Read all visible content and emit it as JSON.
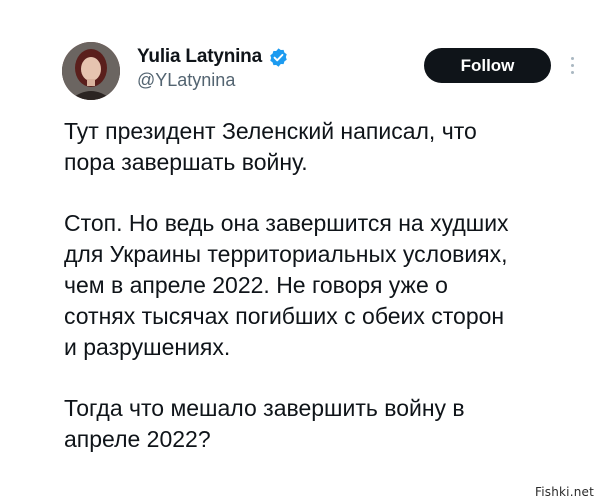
{
  "author": {
    "display_name": "Yulia Latynina",
    "handle": "@YLatynina",
    "verified": true,
    "avatar_icon": "user-avatar"
  },
  "actions": {
    "follow_label": "Follow",
    "more_icon": "more-vertical-icon"
  },
  "tweet": {
    "paragraphs": [
      [
        "Тут президент Зеленский написал, что",
        "пора завершать войну."
      ],
      [
        "Стоп. Но ведь она завершится на худших",
        "для Украины территориальных условиях,",
        "чем в апреле 2022. Не говоря уже о",
        "сотнях тысячах погибших с обеих сторон",
        "и разрушениях."
      ],
      [
        "Тогда что мешало завершить войну в",
        "апреле 2022?"
      ]
    ]
  },
  "watermark": "Fishki.net",
  "colors": {
    "text": "#0f1419",
    "secondary": "#536471",
    "follow_bg": "#0f1419",
    "verified": "#1d9bf0"
  }
}
